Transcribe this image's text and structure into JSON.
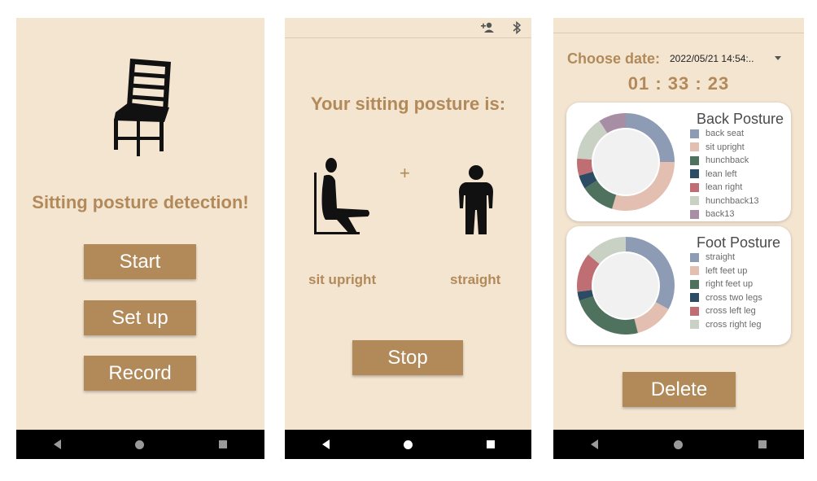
{
  "colors": {
    "background": "#f4e5d1",
    "accent": "#b28a5a",
    "navbar": "#000000"
  },
  "screen1": {
    "icon": "chair-icon",
    "title": "Sitting posture detection!",
    "buttons": {
      "start": "Start",
      "setup": "Set up",
      "record": "Record"
    }
  },
  "screen2": {
    "toolbar_icons": [
      "add-user-icon",
      "bluetooth-icon"
    ],
    "title": "Your sitting posture is:",
    "plus": "+",
    "back_label": "sit upright",
    "foot_label": "straight",
    "stop": "Stop"
  },
  "screen3": {
    "choose_label": "Choose date:",
    "date_value": "2022/05/21 14:54:..",
    "timer": "01 : 33 : 23",
    "back_card": {
      "title": "Back Posture",
      "legend": [
        {
          "label": "back seat",
          "color": "#8e9bb4",
          "share": 0.22
        },
        {
          "label": "sit upright",
          "color": "#e2bfb0",
          "share": 0.26
        },
        {
          "label": "hunchback",
          "color": "#4f725f",
          "share": 0.1
        },
        {
          "label": "lean left",
          "color": "#2c4c63",
          "share": 0.04
        },
        {
          "label": "lean right",
          "color": "#bf6f74",
          "share": 0.05
        },
        {
          "label": "hunchback13",
          "color": "#c9d0c4",
          "share": 0.13
        },
        {
          "label": "back13",
          "color": "#a88ea5",
          "share": 0.08
        }
      ]
    },
    "foot_card": {
      "title": "Foot Posture",
      "legend": [
        {
          "label": "straight",
          "color": "#8e9bb4",
          "share": 0.33
        },
        {
          "label": "left feet up",
          "color": "#e2bfb0",
          "share": 0.13
        },
        {
          "label": "right feet up",
          "color": "#4f725f",
          "share": 0.24
        },
        {
          "label": "cross two legs",
          "color": "#2c4c63",
          "share": 0.03
        },
        {
          "label": "cross left leg",
          "color": "#bf6f74",
          "share": 0.13
        },
        {
          "label": "cross right leg",
          "color": "#c9d0c4",
          "share": 0.14
        }
      ]
    },
    "delete": "Delete"
  }
}
